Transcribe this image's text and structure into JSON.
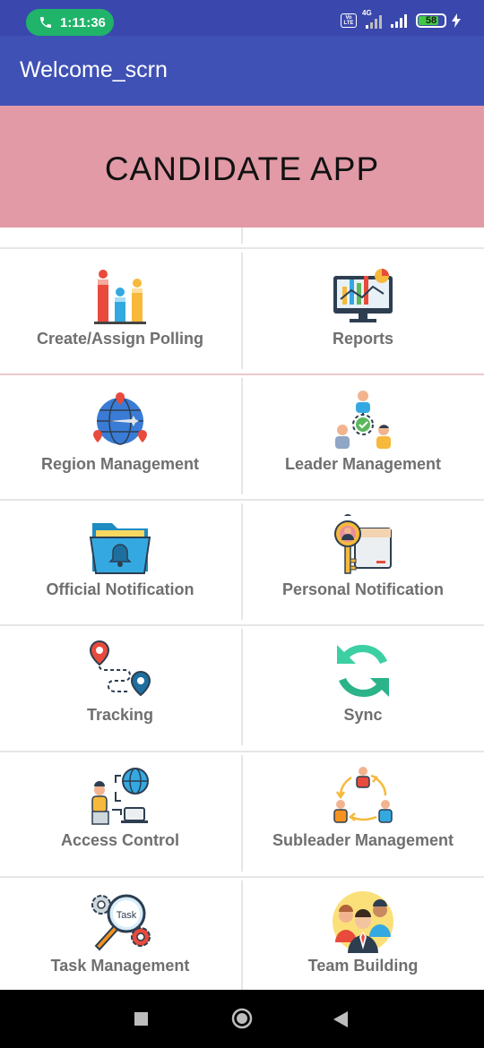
{
  "status_bar": {
    "time": "1:11:36",
    "network": "4G",
    "battery": "58"
  },
  "app_bar": {
    "title": "Welcome_scrn"
  },
  "banner": {
    "text": "CANDIDATE APP",
    "color": "#e29aa6"
  },
  "colors": {
    "app_bar": "#3f51b5",
    "status_bar": "#3a48ad",
    "call_pill": "#20b36a",
    "label": "#6f6f6f"
  },
  "menu": [
    {
      "label": "Create/Assign Polling",
      "icon": "bar-chart-icon"
    },
    {
      "label": "Reports",
      "icon": "monitor-report-icon"
    },
    {
      "label": "Region Management",
      "icon": "globe-pins-icon"
    },
    {
      "label": "Leader Management",
      "icon": "team-hierarchy-icon"
    },
    {
      "label": "Official Notification",
      "icon": "folder-bell-icon"
    },
    {
      "label": "Personal Notification",
      "icon": "key-user-icon"
    },
    {
      "label": "Tracking",
      "icon": "route-pins-icon"
    },
    {
      "label": "Sync",
      "icon": "sync-arrows-icon"
    },
    {
      "label": "Access Control",
      "icon": "user-laptop-icon"
    },
    {
      "label": "Subleader Management",
      "icon": "people-cycle-icon"
    },
    {
      "label": "Task Management",
      "icon": "task-gear-icon"
    },
    {
      "label": "Team Building",
      "icon": "team-people-icon"
    }
  ],
  "icon_text": {
    "task": "Task"
  }
}
